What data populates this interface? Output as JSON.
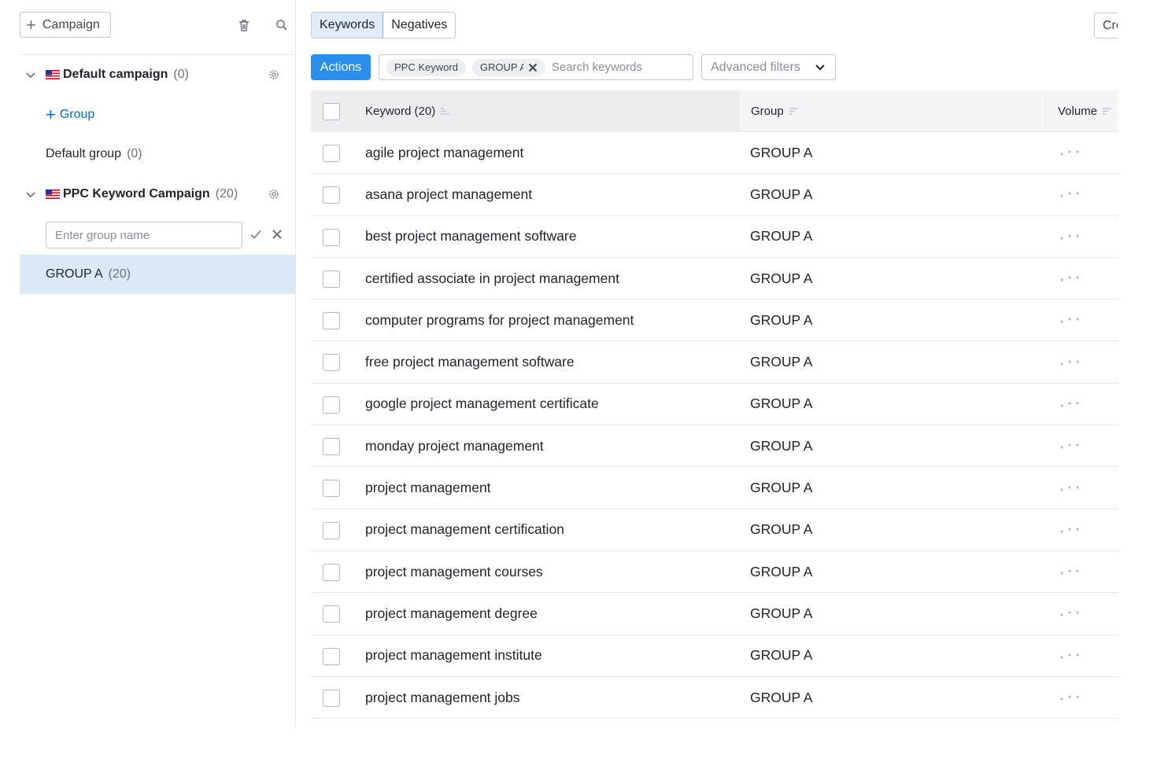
{
  "sidebar": {
    "add_campaign_label": "Campaign",
    "campaigns": [
      {
        "name": "Default campaign",
        "count": "(0)"
      },
      {
        "name": "PPC Keyword Campaign",
        "count": "(20)"
      }
    ],
    "add_group_label": "Group",
    "default_group": {
      "name": "Default group",
      "count": "(0)"
    },
    "group_name_input": {
      "placeholder": "Enter group name",
      "value": ""
    },
    "selected_group": {
      "name": "GROUP A",
      "count": "(20)"
    }
  },
  "tabs": [
    {
      "label": "Keywords",
      "active": true
    },
    {
      "label": "Negatives",
      "active": false
    }
  ],
  "create_button_label": "Cre",
  "toolbar": {
    "actions_label": "Actions",
    "filter_chips": [
      "PPC Keyword",
      "GROUP A"
    ],
    "search_placeholder": "Search keywords",
    "advanced_filters_label": "Advanced filters"
  },
  "table": {
    "headers": {
      "keyword": "Keyword (20)",
      "group": "Group",
      "volume": "Volume"
    },
    "rows": [
      {
        "keyword": "agile project management",
        "group": "GROUP A"
      },
      {
        "keyword": "asana project management",
        "group": "GROUP A"
      },
      {
        "keyword": "best project management software",
        "group": "GROUP A"
      },
      {
        "keyword": "certified associate in project management",
        "group": "GROUP A"
      },
      {
        "keyword": "computer programs for project management",
        "group": "GROUP A"
      },
      {
        "keyword": "free project management software",
        "group": "GROUP A"
      },
      {
        "keyword": "google project management certificate",
        "group": "GROUP A"
      },
      {
        "keyword": "monday project management",
        "group": "GROUP A"
      },
      {
        "keyword": "project management",
        "group": "GROUP A"
      },
      {
        "keyword": "project management certification",
        "group": "GROUP A"
      },
      {
        "keyword": "project management courses",
        "group": "GROUP A"
      },
      {
        "keyword": "project management degree",
        "group": "GROUP A"
      },
      {
        "keyword": "project management institute",
        "group": "GROUP A"
      },
      {
        "keyword": "project management jobs",
        "group": "GROUP A"
      }
    ]
  },
  "icons": {
    "add": "plus-icon",
    "delete": "trash-icon",
    "search": "search-icon",
    "expand": "chevron-down-icon",
    "country": "us-flag-icon",
    "settings": "gear-icon",
    "confirm": "check-icon",
    "cancel": "close-icon",
    "sort": "sort-icon",
    "loading": "loading-dots-icon"
  },
  "colors": {
    "primary": "#2b8eea",
    "link": "#006dca",
    "selected_row": "#dbe9f7",
    "active_tab": "#e0ecfa"
  }
}
